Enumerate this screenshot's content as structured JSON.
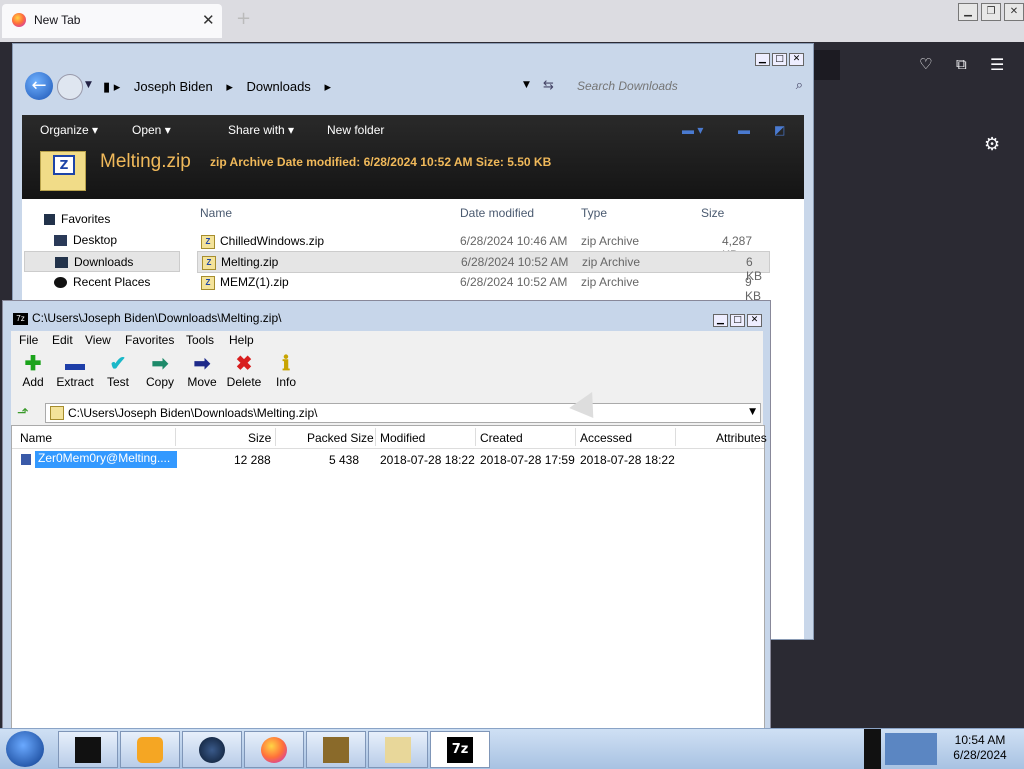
{
  "browser": {
    "tab_title": "New Tab",
    "tab_close": "✕",
    "new_tab": "+",
    "window_buttons": [
      "▁",
      "❐",
      "✕"
    ],
    "icons": {
      "pocket": "pocket-icon",
      "extensions": "extensions-icon",
      "menu": "menu-icon",
      "settings": "gear-icon"
    }
  },
  "explorer": {
    "window_buttons": [
      "▁",
      "□",
      "✕"
    ],
    "breadcrumbs": [
      "Joseph Biden",
      "Downloads"
    ],
    "search_placeholder": "Search Downloads",
    "commands": {
      "organize": "Organize ▾",
      "open": "Open ▾",
      "share": "Share with ▾",
      "new_folder": "New folder"
    },
    "details": {
      "file_name": "Melting.zip",
      "meta": "zip Archive  Date modified: 6/28/2024 10:52 AM    Size: 5.50 KB"
    },
    "nav": {
      "favorites": "Favorites",
      "items": [
        "Desktop",
        "Downloads",
        "Recent Places"
      ]
    },
    "columns": [
      "Name",
      "Date modified",
      "Type",
      "Size"
    ],
    "files": [
      {
        "name": "ChilledWindows.zip",
        "date": "6/28/2024 10:46 AM",
        "type": "zip Archive",
        "size": "4,287 KB"
      },
      {
        "name": "Melting.zip",
        "date": "6/28/2024 10:52 AM",
        "type": "zip Archive",
        "size": "6 KB"
      },
      {
        "name": "MEMZ(1).zip",
        "date": "6/28/2024 10:52 AM",
        "type": "zip Archive",
        "size": "9 KB"
      }
    ]
  },
  "sevenzip": {
    "title": "C:\\Users\\Joseph Biden\\Downloads\\Melting.zip\\",
    "icon_label": "7z",
    "window_buttons": [
      "▁",
      "□",
      "✕"
    ],
    "menu": [
      "File",
      "Edit",
      "View",
      "Favorites",
      "Tools",
      "Help"
    ],
    "toolbar": [
      {
        "label": "Add",
        "glyph": "✚",
        "color": "#1aa31a"
      },
      {
        "label": "Extract",
        "glyph": "▬",
        "color": "#1e3ea8"
      },
      {
        "label": "Test",
        "glyph": "✔",
        "color": "#1ab8c8"
      },
      {
        "label": "Copy",
        "glyph": "➡",
        "color": "#1d8a6a"
      },
      {
        "label": "Move",
        "glyph": "➡",
        "color": "#1e2a8a"
      },
      {
        "label": "Delete",
        "glyph": "✖",
        "color": "#d81e1e"
      },
      {
        "label": "Info",
        "glyph": "ℹ",
        "color": "#c8a400"
      }
    ],
    "path": "C:\\Users\\Joseph Biden\\Downloads\\Melting.zip\\",
    "columns": [
      "Name",
      "Size",
      "Packed Size",
      "Modified",
      "Created",
      "Accessed",
      "Attributes"
    ],
    "row": {
      "name": "Zer0Mem0ry@Melting....",
      "size": "12 288",
      "packed": "5 438",
      "modified": "2018-07-28 18:22",
      "created": "2018-07-28 17:59",
      "accessed": "2018-07-28 18:22"
    }
  },
  "taskbar": {
    "apps": [
      "explorer",
      "media-player",
      "chrome-dark",
      "firefox",
      "box-game",
      "folder",
      "7zip"
    ],
    "seven_label": "7z",
    "clock_time": "10:54 AM",
    "clock_date": "6/28/2024"
  }
}
